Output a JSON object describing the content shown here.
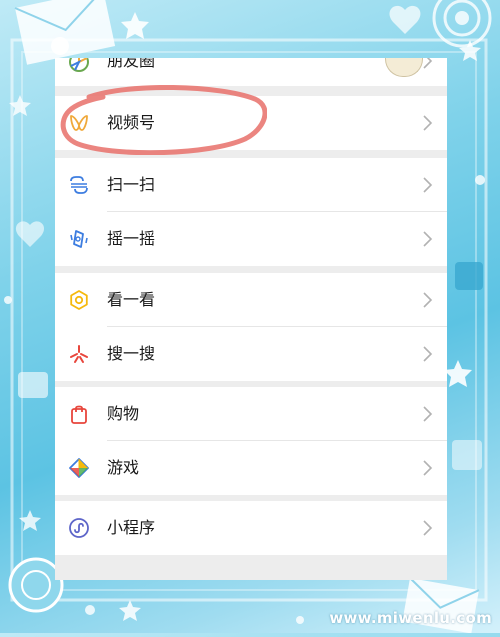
{
  "menu": {
    "moments_label": "朋友圈",
    "channels_label": "视频号",
    "scan_label": "扫一扫",
    "shake_label": "摇一摇",
    "top_stories_label": "看一看",
    "search_label": "搜一搜",
    "shopping_label": "购物",
    "games_label": "游戏",
    "mini_programs_label": "小程序"
  },
  "icons": {
    "moments": "moments-aperture-icon",
    "channels": "channels-butterfly-icon",
    "scan": "scan-icon",
    "shake": "shake-icon",
    "top_stories": "top-stories-icon",
    "search": "search-sparkle-icon",
    "shopping": "shopping-bag-icon",
    "games": "games-diamond-icon",
    "mini_programs": "mini-programs-icon",
    "chevron": "chevron-right-icon"
  },
  "colors": {
    "annotation_circle": "#e8706a",
    "channels_icon": "#f0a93b",
    "scan_icon": "#3d7de0",
    "top_stories_icon": "#f5b90d",
    "search_icon": "#e8463c",
    "shopping_icon": "#e8463c",
    "mini_programs_icon": "#5d65c9"
  },
  "watermark": "www.miwenlu.com"
}
